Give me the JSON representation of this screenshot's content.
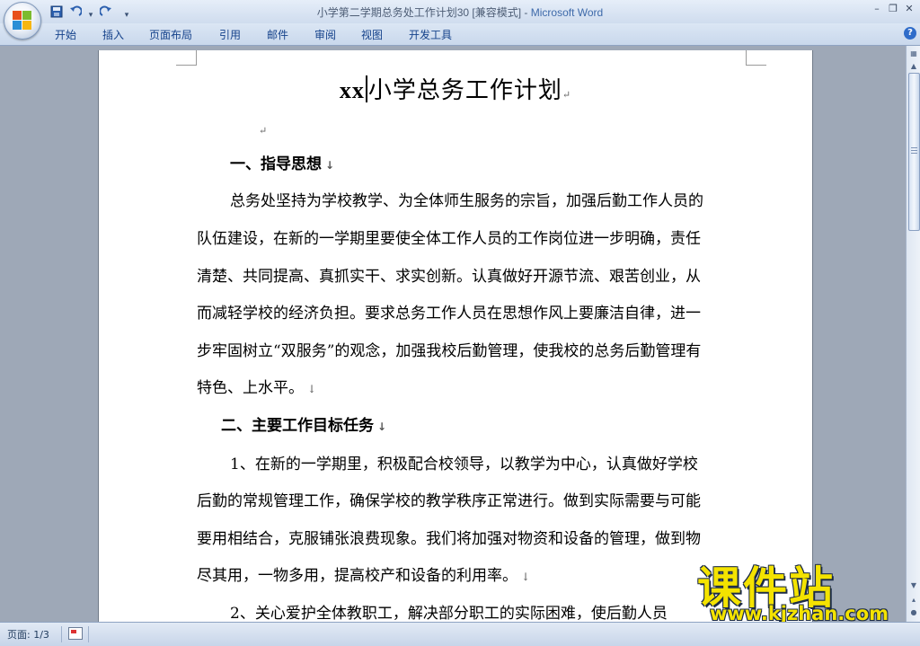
{
  "window": {
    "title_doc": "小学第二学期总务处工作计划30 [兼容模式] - ",
    "title_app": "Microsoft Word"
  },
  "ribbon": {
    "tabs": [
      "开始",
      "插入",
      "页面布局",
      "引用",
      "邮件",
      "审阅",
      "视图",
      "开发工具"
    ]
  },
  "document": {
    "title_prefix": "xx",
    "title_text": "小学总务工作计划",
    "heading1": "一、指导思想",
    "para1": [
      "总务处坚持为学校教学、为全体师生服务的宗旨，加强后勤工作人员的",
      "队伍建设，在新的一学期里要使全体工作人员的工作岗位进一步明确，责任",
      "清楚、共同提高、真抓实干、求实创新。认真做好开源节流、艰苦创业，从",
      "而减轻学校的经济负担。要求总务工作人员在思想作风上要廉洁自律，进一",
      "步牢固树立“双服务”的观念，加强我校后勤管理，使我校的总务后勤管理有",
      "特色、上水平。"
    ],
    "heading2": "二、主要工作目标任务",
    "para2": [
      "1、在新的一学期里，积极配合校领导，以教学为中心，认真做好学校",
      "后勤的常规管理工作，确保学校的教学秩序正常进行。做到实际需要与可能",
      "要用相结合，克服铺张浪费现象。我们将加强对物资和设备的管理，做到物",
      "尽其用，一物多用，提高校产和设备的利用率。"
    ],
    "para3_line1": "2、关心爱护全体教职工，解决部分职工的实际困难，使后勤人员"
  },
  "status": {
    "page": "页面: 1/3"
  },
  "watermark": {
    "main": "课件站",
    "url": "www.kjzhan.com"
  }
}
